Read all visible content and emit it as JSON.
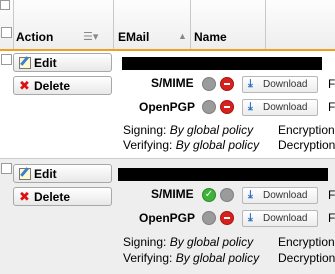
{
  "header": {
    "action_label": "Action",
    "email_label": "EMail",
    "name_label": "Name"
  },
  "rows": [
    {
      "edit_label": "Edit",
      "delete_label": "Delete",
      "email": "",
      "smime": {
        "label": "S/MIME",
        "download_label": "Download",
        "trailing": "F"
      },
      "openpgp": {
        "label": "OpenPGP",
        "download_label": "Download",
        "trailing": "F"
      },
      "signing_label": "Signing:",
      "signing_value": "By global policy",
      "encryption_label": "Encryption",
      "verifying_label": "Verifying:",
      "verifying_value": "By global policy",
      "decryption_label": "Decryption"
    },
    {
      "edit_label": "Edit",
      "delete_label": "Delete",
      "email": "",
      "smime": {
        "label": "S/MIME",
        "download_label": "Download",
        "trailing": "F"
      },
      "openpgp": {
        "label": "OpenPGP",
        "download_label": "Download",
        "trailing": "F"
      },
      "signing_label": "Signing:",
      "signing_value": "By global policy",
      "encryption_label": "Encryption",
      "verifying_label": "Verifying:",
      "verifying_value": "By global policy",
      "decryption_label": "Decryption"
    }
  ],
  "colors": {
    "header_underline": "#f0a020",
    "status_red": "#d8211c",
    "status_green": "#3fb23a",
    "status_grey": "#9b9b9b"
  },
  "icons": [
    "edit-icon",
    "delete-icon",
    "download-icon",
    "column-menu-icon",
    "sort-icon"
  ]
}
